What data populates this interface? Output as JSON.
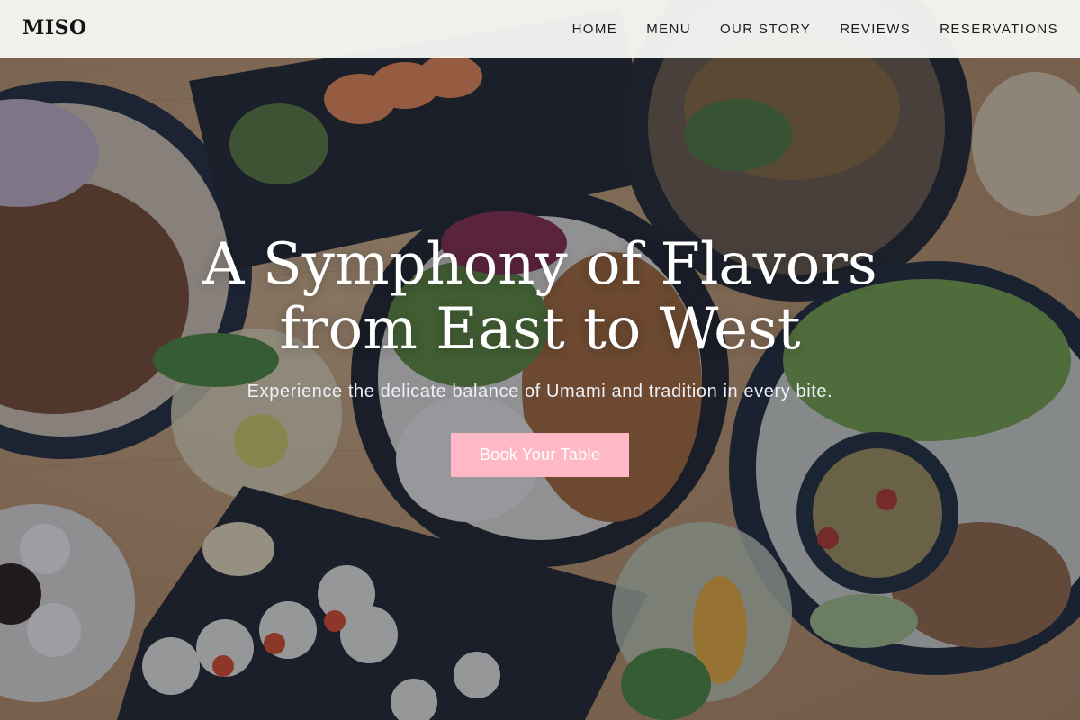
{
  "brand": {
    "logo": "MISO"
  },
  "nav": {
    "items": [
      {
        "label": "HOME"
      },
      {
        "label": "MENU"
      },
      {
        "label": "OUR STORY"
      },
      {
        "label": "REVIEWS"
      },
      {
        "label": "RESERVATIONS"
      }
    ]
  },
  "hero": {
    "title_line_1": "A Symphony of Flavors",
    "title_line_2": "from East to West",
    "subtitle": "Experience the delicate balance of Umami and tradition in every bite.",
    "cta_label": "Book Your Table"
  },
  "colors": {
    "accent": "#ffb8c6",
    "navbar_bg": "#f8f8f6",
    "hero_text": "#ffffff"
  }
}
